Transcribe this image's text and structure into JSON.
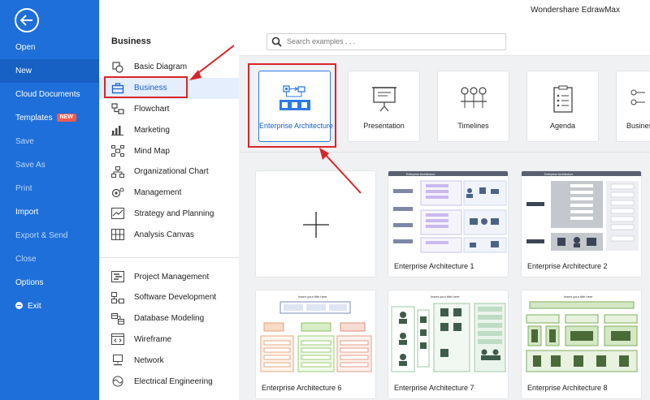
{
  "app": {
    "title": "Wondershare EdrawMax"
  },
  "leftnav": {
    "items": [
      {
        "label": "Open"
      },
      {
        "label": "New"
      },
      {
        "label": "Cloud Documents"
      },
      {
        "label": "Templates",
        "badge": "NEW"
      },
      {
        "label": "Save"
      },
      {
        "label": "Save As"
      },
      {
        "label": "Print"
      },
      {
        "label": "Import"
      },
      {
        "label": "Export & Send"
      },
      {
        "label": "Close"
      },
      {
        "label": "Options"
      },
      {
        "label": "Exit"
      }
    ]
  },
  "header": {
    "section_title": "Business",
    "search_placeholder": "Search examples . . ."
  },
  "categories": {
    "group1": [
      {
        "label": "Basic Diagram",
        "icon": "basic-diagram-icon"
      },
      {
        "label": "Business",
        "icon": "briefcase-icon"
      },
      {
        "label": "Flowchart",
        "icon": "flowchart-icon"
      },
      {
        "label": "Marketing",
        "icon": "bar-chart-icon"
      },
      {
        "label": "Mind Map",
        "icon": "mind-map-icon"
      },
      {
        "label": "Organizational Chart",
        "icon": "org-chart-icon"
      },
      {
        "label": "Management",
        "icon": "management-icon"
      },
      {
        "label": "Strategy and Planning",
        "icon": "strategy-icon"
      },
      {
        "label": "Analysis Canvas",
        "icon": "canvas-icon"
      }
    ],
    "group2": [
      {
        "label": "Project Management",
        "icon": "project-icon"
      },
      {
        "label": "Software Development",
        "icon": "software-icon"
      },
      {
        "label": "Database Modeling",
        "icon": "database-icon"
      },
      {
        "label": "Wireframe",
        "icon": "wireframe-icon"
      },
      {
        "label": "Network",
        "icon": "network-icon"
      },
      {
        "label": "Electrical Engineering",
        "icon": "electrical-icon"
      }
    ]
  },
  "template_types": [
    {
      "label": "Enterprise Architecture",
      "icon": "enterprise-architecture-icon"
    },
    {
      "label": "Presentation",
      "icon": "presentation-icon"
    },
    {
      "label": "Timelines",
      "icon": "timeline-icon"
    },
    {
      "label": "Agenda",
      "icon": "agenda-icon"
    },
    {
      "label": "Busines",
      "icon": "business-icon"
    }
  ],
  "gallery": [
    {
      "label": ""
    },
    {
      "label": "Enterprise Architecture 1"
    },
    {
      "label": "Enterprise Architecture 2"
    },
    {
      "label": "Enterprise Architecture 6"
    },
    {
      "label": "Enterprise Architecture 7"
    },
    {
      "label": "Enterprise Architecture 8"
    }
  ],
  "thumbs": {
    "ea1_title": "Enterprise Architecture",
    "ea2_title": "Enterprise Architecture",
    "insert_title": "Insert your title here"
  },
  "colors": {
    "nav_blue": "#1e6fd9",
    "accent": "#2d7be5",
    "highlight_red": "#d9252a"
  }
}
